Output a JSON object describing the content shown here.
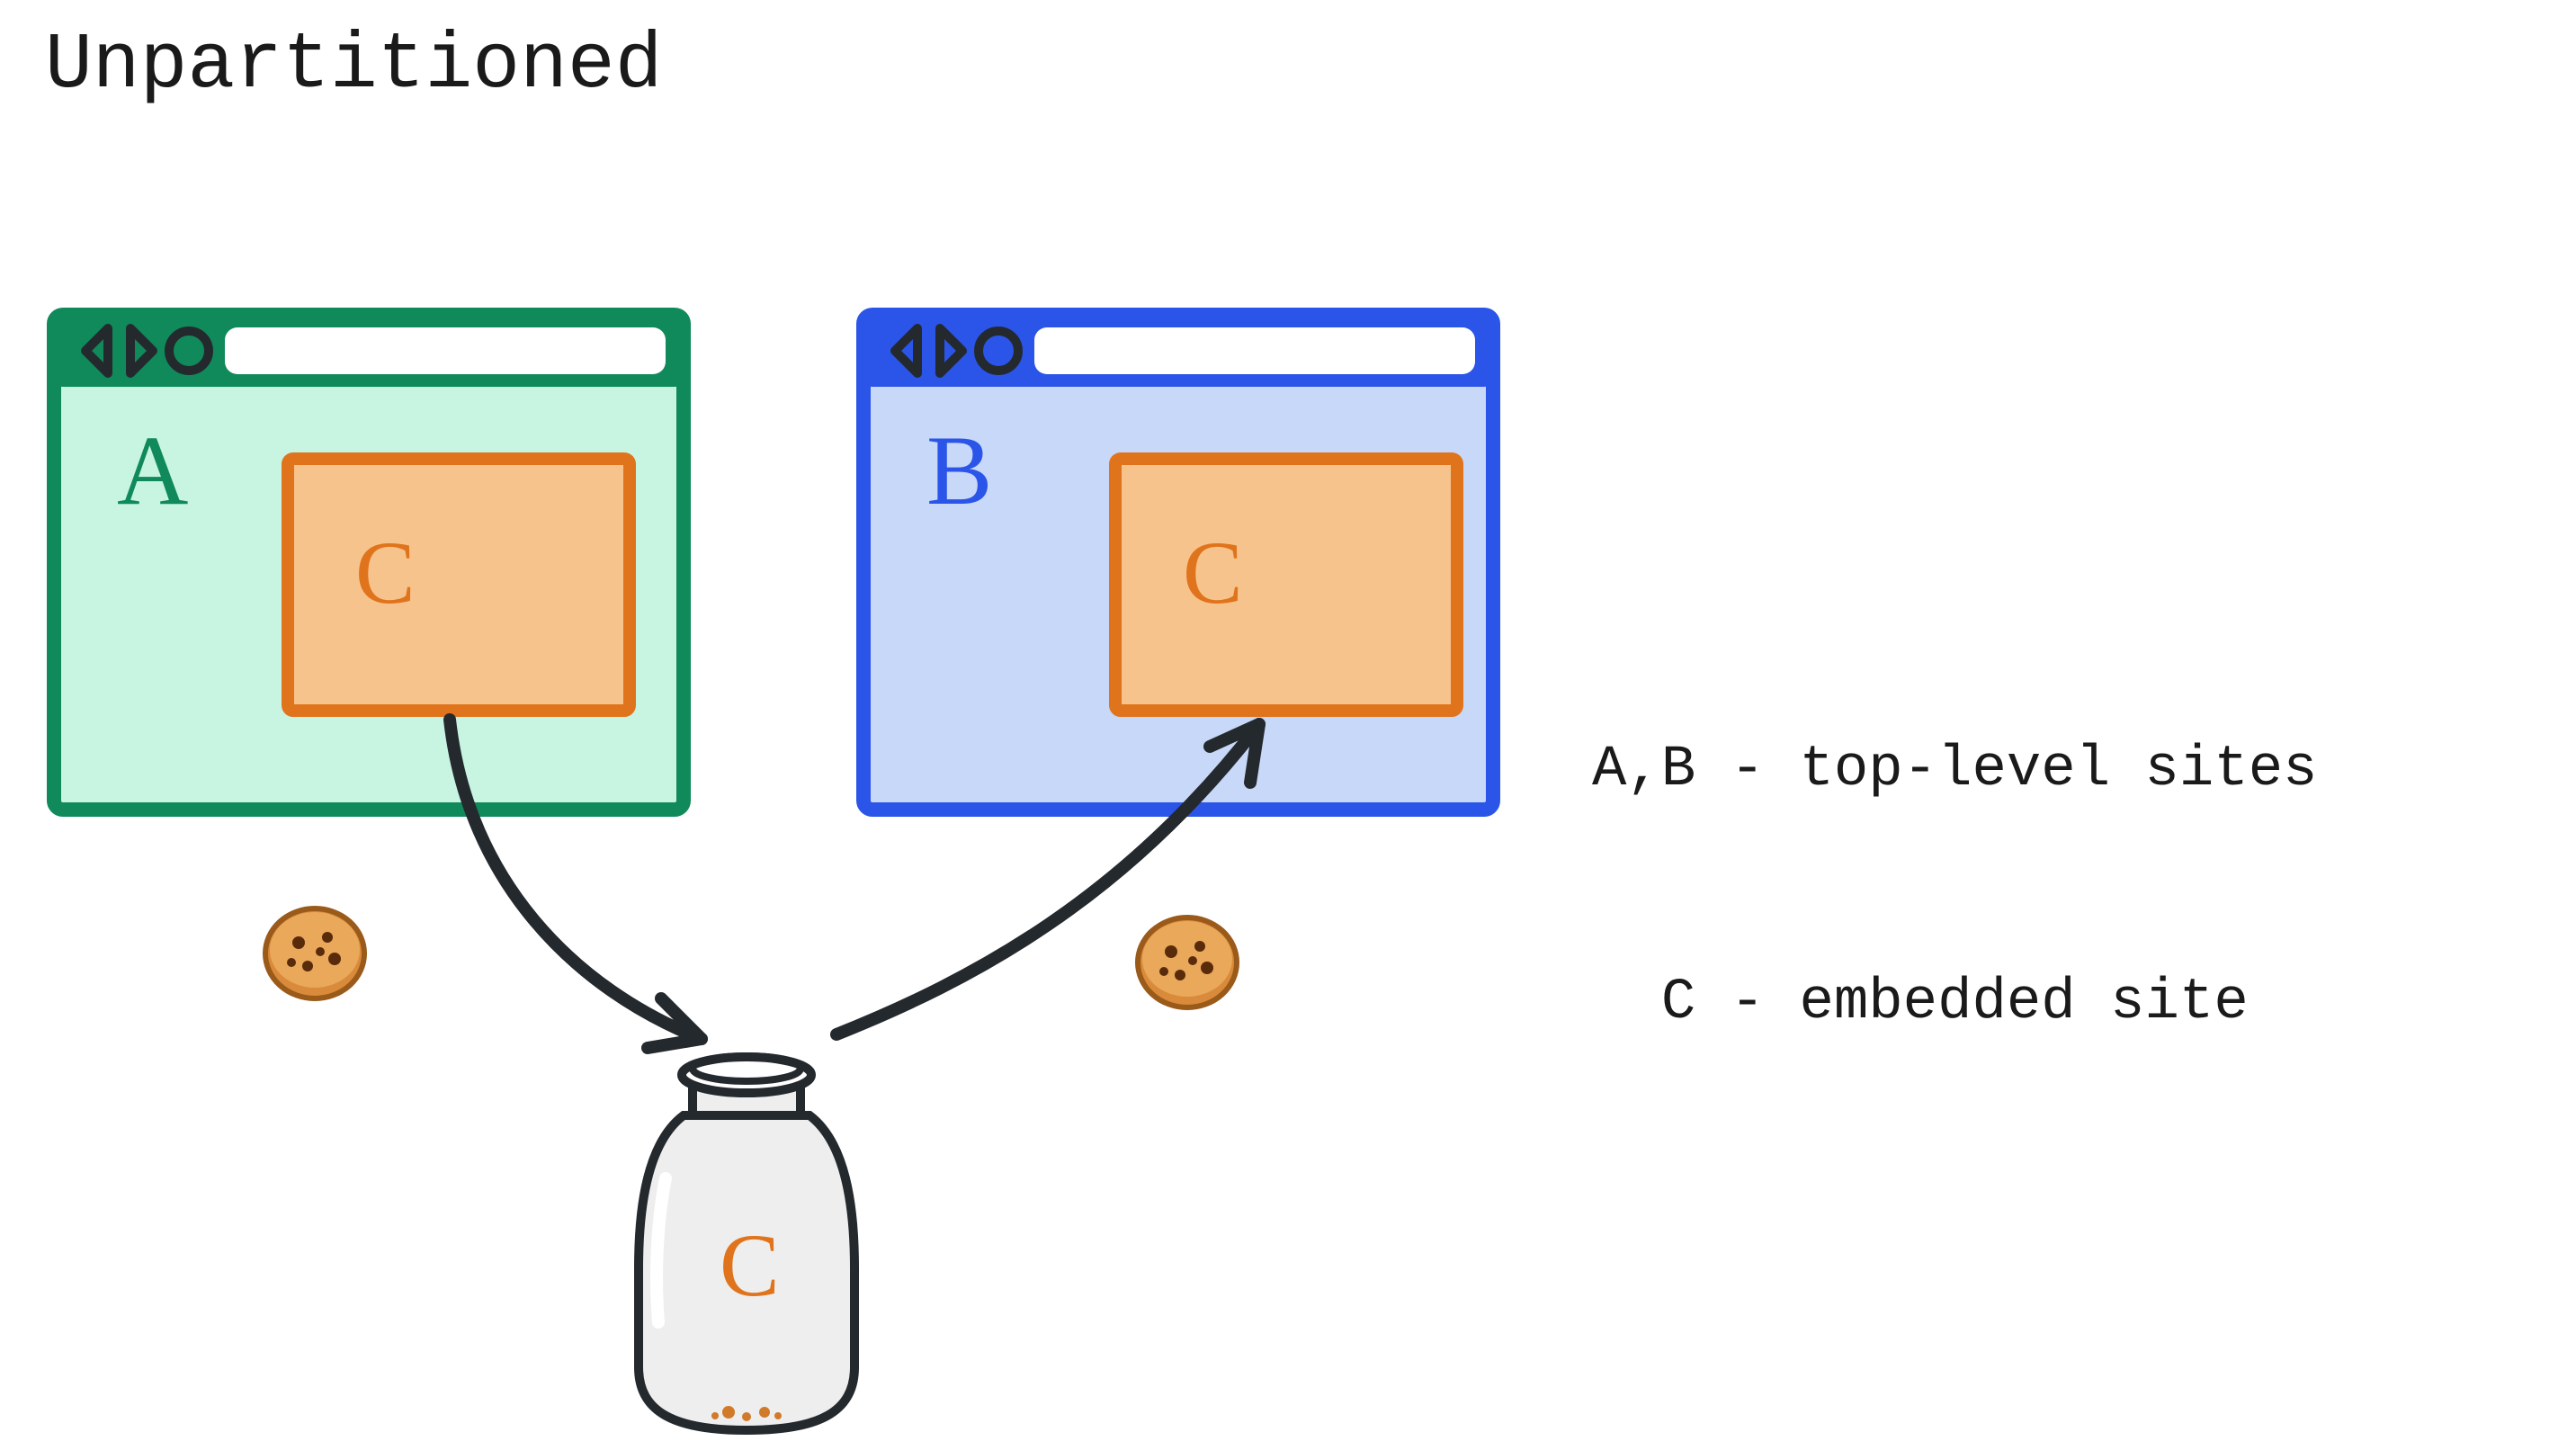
{
  "title": "Unpartitioned",
  "browsers": {
    "a": {
      "label": "A",
      "embedded_label": "C"
    },
    "b": {
      "label": "B",
      "embedded_label": "C"
    }
  },
  "jar": {
    "label": "C"
  },
  "legend": {
    "line1": "A,B - top-level sites",
    "line2": "  C - embedded site"
  },
  "colors": {
    "green_stroke": "#108a5a",
    "green_fill": "#c8f5e2",
    "blue_stroke": "#2a55e8",
    "blue_fill": "#c8d8f8",
    "orange_stroke": "#e0741c",
    "orange_fill": "#f7c38c",
    "dark": "#24292e",
    "title": "#1a1a1a",
    "jar_fill": "#eeeeee"
  }
}
